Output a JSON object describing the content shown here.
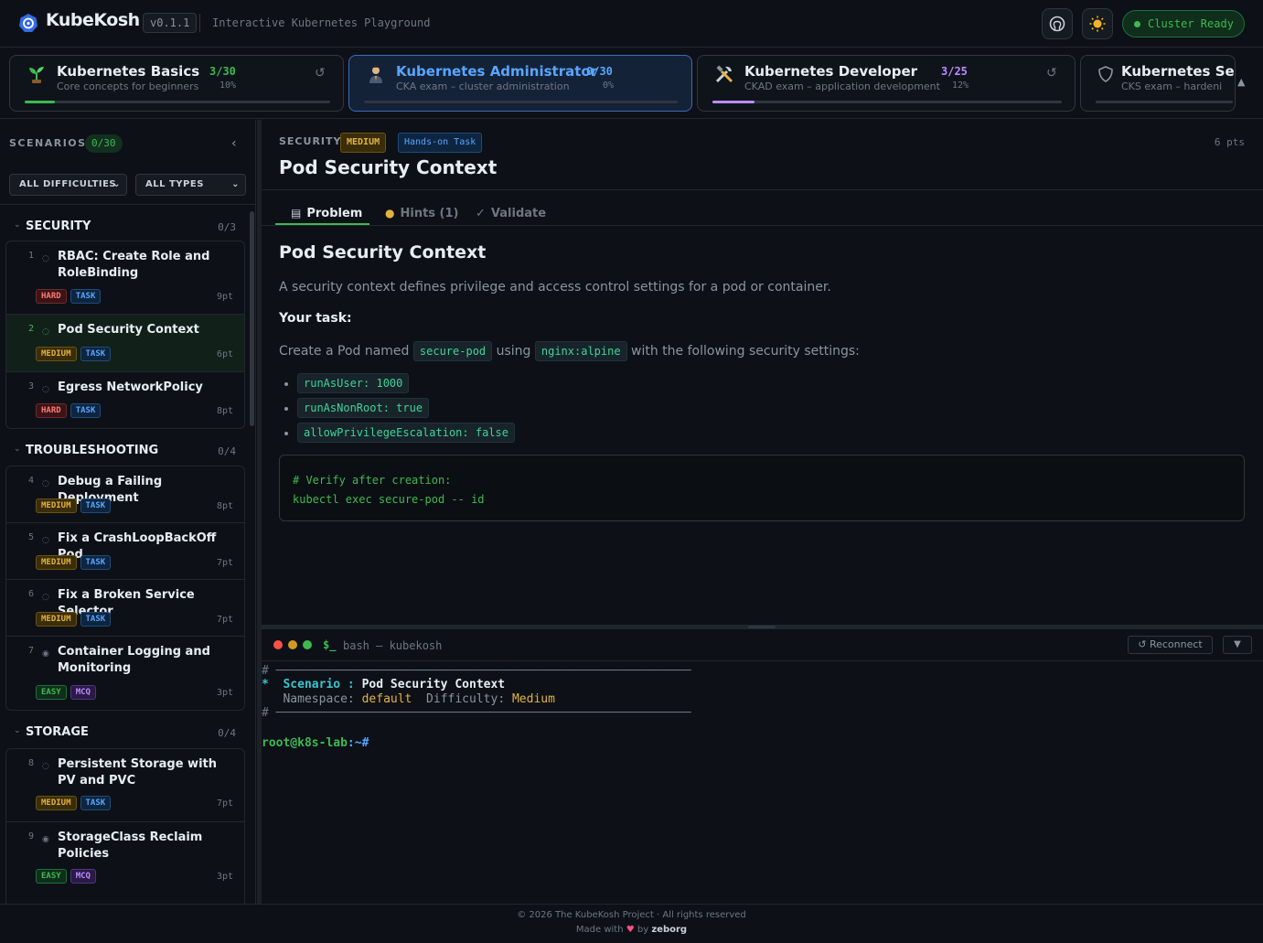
{
  "header": {
    "app_name": "KubeKosh",
    "version": "v0.1.1",
    "tagline": "Interactive Kubernetes Playground",
    "cluster_status": "Cluster Ready"
  },
  "tracks": [
    {
      "name": "Kubernetes Basics",
      "desc": "Core concepts for beginners",
      "count": "3/30",
      "pct": "10%",
      "progress": 0.1,
      "color": "#3fb950",
      "icon": "seedling-icon"
    },
    {
      "name": "Kubernetes Administrator",
      "desc": "CKA exam – cluster administration",
      "count": "0/30",
      "pct": "0%",
      "progress": 0.0,
      "color": "#58a6ff",
      "icon": "admin-user-icon"
    },
    {
      "name": "Kubernetes Developer",
      "desc": "CKAD exam – application development",
      "count": "3/25",
      "pct": "12%",
      "progress": 0.12,
      "color": "#bc8cff",
      "icon": "tools-icon"
    },
    {
      "name": "Kubernetes Se",
      "desc": "CKS exam – hardeni",
      "icon": "shield-icon"
    }
  ],
  "sidebar": {
    "title": "SCENARIOS",
    "count": "0/30",
    "filter_difficulty": "ALL DIFFICULTIES",
    "filter_type": "ALL TYPES",
    "categories": [
      {
        "name": "SECURITY",
        "count": "0/3",
        "items": [
          {
            "num": "1",
            "title": "RBAC: Create Role and RoleBinding",
            "diff": "HARD",
            "type": "TASK",
            "pts": "9pt"
          },
          {
            "num": "2",
            "title": "Pod Security Context",
            "diff": "MEDIUM",
            "type": "TASK",
            "pts": "6pt"
          },
          {
            "num": "3",
            "title": "Egress NetworkPolicy",
            "diff": "HARD",
            "type": "TASK",
            "pts": "8pt"
          }
        ]
      },
      {
        "name": "TROUBLESHOOTING",
        "count": "0/4",
        "items": [
          {
            "num": "4",
            "title": "Debug a Failing Deployment",
            "diff": "MEDIUM",
            "type": "TASK",
            "pts": "8pt"
          },
          {
            "num": "5",
            "title": "Fix a CrashLoopBackOff Pod",
            "diff": "MEDIUM",
            "type": "TASK",
            "pts": "7pt"
          },
          {
            "num": "6",
            "title": "Fix a Broken Service Selector",
            "diff": "MEDIUM",
            "type": "TASK",
            "pts": "7pt"
          },
          {
            "num": "7",
            "title": "Container Logging and Monitoring",
            "diff": "EASY",
            "type": "MCQ",
            "pts": "3pt"
          }
        ]
      },
      {
        "name": "STORAGE",
        "count": "0/4",
        "items": [
          {
            "num": "8",
            "title": "Persistent Storage with PV and PVC",
            "diff": "MEDIUM",
            "type": "TASK",
            "pts": "7pt"
          },
          {
            "num": "9",
            "title": "StorageClass Reclaim Policies",
            "diff": "EASY",
            "type": "MCQ",
            "pts": "3pt"
          }
        ]
      }
    ]
  },
  "main": {
    "category": "SECURITY",
    "difficulty": "MEDIUM",
    "type": "Hands-on Task",
    "points": "6 pts",
    "title": "Pod Security Context",
    "tabs": {
      "problem": "Problem",
      "hints": "Hints (1)",
      "validate": "Validate"
    },
    "content": {
      "heading": "Pod Security Context",
      "intro": "A security context defines privilege and access control settings for a pod or container.",
      "task_label": "Your task:",
      "task_pre": "Create a Pod named",
      "pod_name": "secure-pod",
      "task_mid": "using",
      "image": "nginx:alpine",
      "task_post": "with the following security settings:",
      "settings": [
        "runAsUser: 1000",
        "runAsNonRoot: true",
        "allowPrivilegeEscalation: false"
      ],
      "code_comment": "# Verify after creation:",
      "code_cmd": "kubectl exec secure-pod -- id"
    }
  },
  "terminal": {
    "prompt_symbol": "$_",
    "title": "bash — kubekosh",
    "reconnect": "↺ Reconnect",
    "scenario_label": "Scenario",
    "scenario_value": "Pod Security Context",
    "ns_label": "Namespace:",
    "ns_value": "default",
    "diff_label": "Difficulty:",
    "diff_value": "Medium",
    "prompt_user": "root@k8s-lab",
    "prompt_path": ":~#"
  },
  "footer": {
    "copyright": "© 2026 The KubeKosh Project · All rights reserved",
    "made_with": "Made with",
    "by": "by",
    "author": "zeborg"
  }
}
